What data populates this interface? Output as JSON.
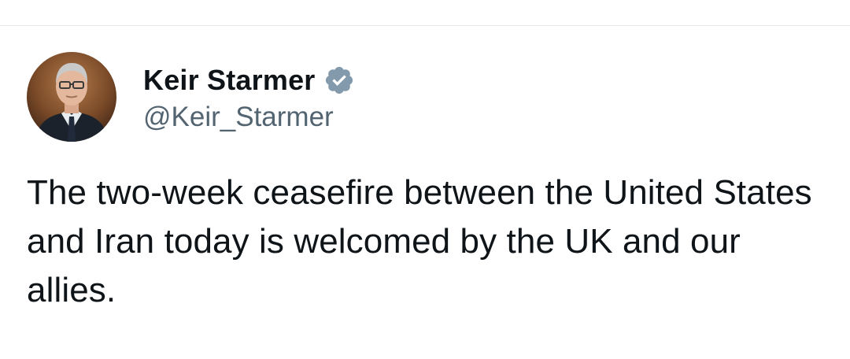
{
  "tweet": {
    "author": {
      "display_name": "Keir Starmer",
      "handle": "@Keir_Starmer",
      "verified": true,
      "verified_badge_color": "#829aab"
    },
    "text": "The two-week ceasefire between the United States and Iran today is welcomed by the UK and our allies."
  },
  "colors": {
    "text_primary": "#0f1419",
    "text_secondary": "#536471",
    "divider": "#e6e6e6"
  }
}
